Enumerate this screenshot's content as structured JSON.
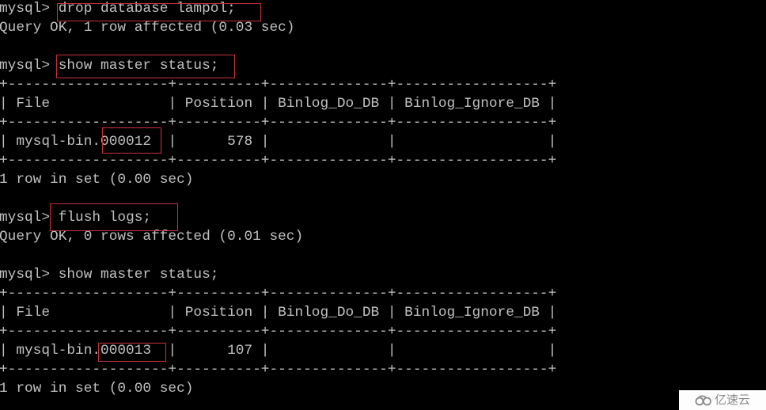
{
  "terminal": {
    "prompt": "mysql> ",
    "lines": [
      {
        "kind": "command",
        "text": "drop database lampol;"
      },
      {
        "kind": "output",
        "text": "Query OK, 1 row affected (0.03 sec)"
      },
      {
        "kind": "blank",
        "text": ""
      },
      {
        "kind": "command",
        "text": "show master status;"
      },
      {
        "kind": "border",
        "text": "+-------------------+----------+--------------+------------------+"
      },
      {
        "kind": "header",
        "text": "| File              | Position | Binlog_Do_DB | Binlog_Ignore_DB |"
      },
      {
        "kind": "border",
        "text": "+-------------------+----------+--------------+------------------+"
      },
      {
        "kind": "row",
        "text": "| mysql-bin.000012  |      578 |              |                  |"
      },
      {
        "kind": "border",
        "text": "+-------------------+----------+--------------+------------------+"
      },
      {
        "kind": "output",
        "text": "1 row in set (0.00 sec)"
      },
      {
        "kind": "blank",
        "text": ""
      },
      {
        "kind": "command",
        "text": "flush logs;"
      },
      {
        "kind": "output",
        "text": "Query OK, 0 rows affected (0.01 sec)"
      },
      {
        "kind": "blank",
        "text": ""
      },
      {
        "kind": "command",
        "text": "show master status;"
      },
      {
        "kind": "border",
        "text": "+-------------------+----------+--------------+------------------+"
      },
      {
        "kind": "header",
        "text": "| File              | Position | Binlog_Do_DB | Binlog_Ignore_DB |"
      },
      {
        "kind": "border",
        "text": "+-------------------+----------+--------------+------------------+"
      },
      {
        "kind": "row",
        "text": "| mysql-bin.000013  |      107 |              |                  |"
      },
      {
        "kind": "border",
        "text": "+-------------------+----------+--------------+------------------+"
      },
      {
        "kind": "output",
        "text": "1 row in set (0.00 sec)"
      }
    ]
  },
  "tables": [
    {
      "columns": [
        "File",
        "Position",
        "Binlog_Do_DB",
        "Binlog_Ignore_DB"
      ],
      "rows": [
        [
          "mysql-bin.000012",
          "578",
          "",
          ""
        ]
      ]
    },
    {
      "columns": [
        "File",
        "Position",
        "Binlog_Do_DB",
        "Binlog_Ignore_DB"
      ],
      "rows": [
        [
          "mysql-bin.000013",
          "107",
          "",
          ""
        ]
      ]
    }
  ],
  "highlights": [
    {
      "label": "drop database lampol;"
    },
    {
      "label": "show master status;"
    },
    {
      "label": "flush logs;"
    },
    {
      "label": "000012"
    },
    {
      "label": "000013"
    }
  ],
  "colors": {
    "background": "#000000",
    "text": "#c0c0c0",
    "highlight_border": "#c8323c"
  },
  "watermark": {
    "icon": "cloud-logo-icon",
    "text": "亿速云"
  }
}
